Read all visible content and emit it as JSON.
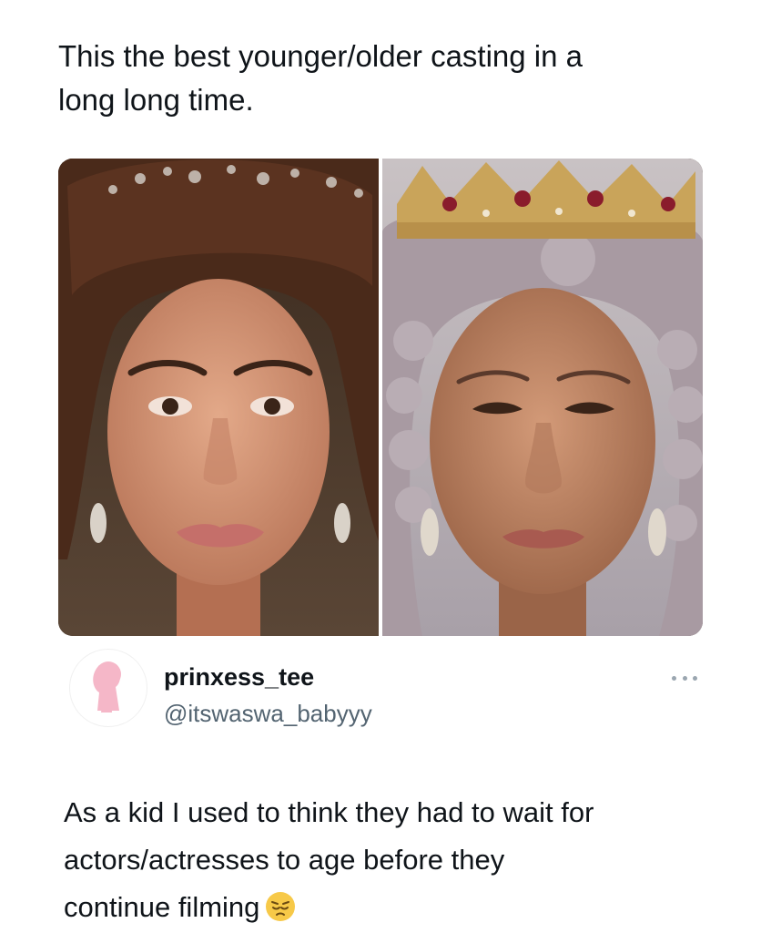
{
  "top_tweet": {
    "text_line1": "This the best younger/older casting in a",
    "text_line2": "long long time."
  },
  "reply": {
    "display_name": "prinxess_tee",
    "handle": "@itswaswa_babyyy",
    "text_line1": "As a kid I used to think they had to wait for",
    "text_line2": "actors/actresses to age before they",
    "text_line3": "continue filming",
    "emoji_icon": "pensive-face-icon"
  },
  "media": {
    "left_image": "young-queen-portrait",
    "right_image": "older-queen-portrait"
  },
  "colors": {
    "text_primary": "#0f1419",
    "text_secondary": "#536471",
    "avatar_silhouette": "#f5b7c8"
  }
}
